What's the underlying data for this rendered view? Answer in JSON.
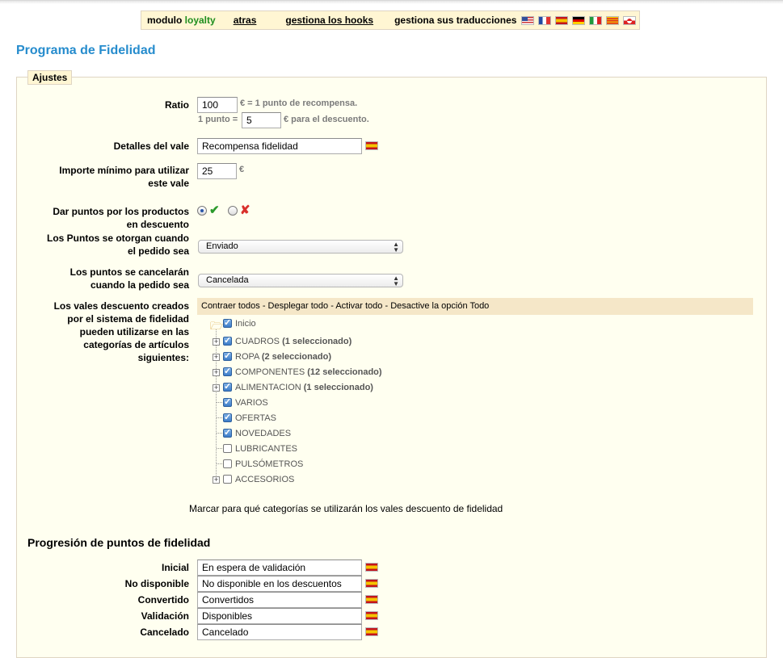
{
  "header": {
    "module_prefix": "modulo",
    "module_name": "loyalty",
    "back_link": "atras",
    "hooks_link": "gestiona los hooks",
    "translations_label": "gestiona sus traducciones",
    "flags": [
      "us-flag",
      "fr-flag",
      "es-flag",
      "de-flag",
      "it-flag",
      "ca-flag",
      "gl-flag"
    ]
  },
  "page": {
    "title": "Programa de Fidelidad"
  },
  "settings": {
    "legend": "Ajustes",
    "ratio": {
      "label": "Ratio",
      "value": "100",
      "suffix": "€ = 1 punto de recompensa.",
      "point_prefix": "1 punto =",
      "point_value": "5",
      "point_suffix": "€ para el descuento."
    },
    "voucher_details": {
      "label": "Detalles del vale",
      "value": "Recompensa fidelidad"
    },
    "minimum": {
      "label_line1": "Importe mínimo para utilizar",
      "label_line2": "este vale",
      "value": "25",
      "suffix": "€"
    },
    "discounted": {
      "label_line1": "Dar puntos por los productos",
      "label_line2": "en descuento"
    },
    "awarded": {
      "label_line1": "Los Puntos se otorgan cuando",
      "label_line2": "el pedido sea",
      "value": "Enviado"
    },
    "cancelled": {
      "label_line1": "Los puntos se cancelarán",
      "label_line2": "cuando la pedido sea",
      "value": "Cancelada"
    },
    "categories": {
      "label_lines": [
        "Los vales descuento creados",
        "por el sistema de fidelidad",
        "pueden utilizarse en las",
        "categorías de artículos",
        "siguientes:"
      ],
      "toolbar": {
        "collapse": "Contraer todos",
        "sep": " - ",
        "expand": "Desplegar todo",
        "check": "Activar todo",
        "uncheck": "Desactive la opción Todo"
      },
      "root": "Inicio",
      "items": [
        {
          "name": "CUADROS",
          "count": "(1 seleccionado)"
        },
        {
          "name": "ROPA",
          "count": "(2 seleccionado)"
        },
        {
          "name": "COMPONENTES",
          "count": "(12 seleccionado)"
        },
        {
          "name": "ALIMENTACION",
          "count": "(1 seleccionado)"
        },
        {
          "name": "VARIOS",
          "count": ""
        },
        {
          "name": "OFERTAS",
          "count": ""
        },
        {
          "name": "NOVEDADES",
          "count": ""
        },
        {
          "name": "LUBRICANTES",
          "count": ""
        },
        {
          "name": "PULSÓMETROS",
          "count": ""
        },
        {
          "name": "ACCESORIOS",
          "count": ""
        }
      ],
      "help": "Marcar para qué categorías se utilizarán los vales descuento de fidelidad"
    }
  },
  "progression": {
    "title": "Progresión de puntos de fidelidad",
    "rows": [
      {
        "label": "Inicial",
        "value": "En espera de validación"
      },
      {
        "label": "No disponible",
        "value": "No disponible en los descuentos"
      },
      {
        "label": "Convertido",
        "value": "Convertidos"
      },
      {
        "label": "Validación",
        "value": "Disponibles"
      },
      {
        "label": "Cancelado",
        "value": "Cancelado"
      }
    ]
  }
}
